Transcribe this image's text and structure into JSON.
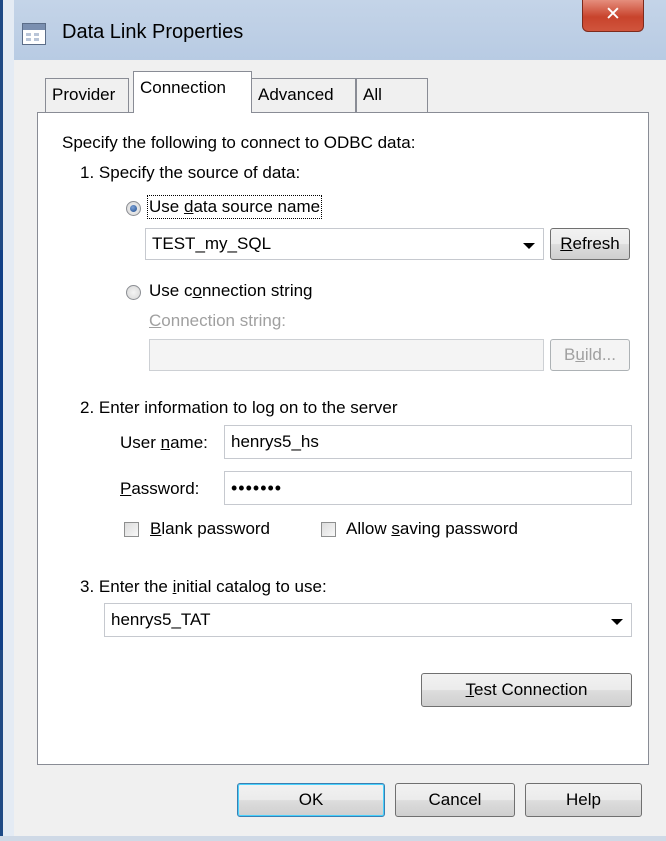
{
  "window": {
    "title": "Data Link Properties",
    "close_glyph": "✕"
  },
  "tabs": [
    {
      "label": "Provider",
      "active": false
    },
    {
      "label": "Connection",
      "active": true
    },
    {
      "label": "Advanced",
      "active": false
    },
    {
      "label": "All",
      "active": false
    }
  ],
  "connection": {
    "intro": "Specify the following to connect to ODBC data:",
    "step1": "1. Specify the source of data:",
    "use_dsn": {
      "pre": "Use ",
      "access_key": "d",
      "post": "ata source name",
      "checked": true
    },
    "dsn_value": "TEST_my_SQL",
    "refresh": {
      "access_key": "R",
      "post": "efresh"
    },
    "use_connstr": {
      "pre": "Use c",
      "access_key": "o",
      "post": "nnection string",
      "checked": false
    },
    "connstr_label": {
      "access_key": "C",
      "post": "onnection string:"
    },
    "connstr_value": "",
    "build": {
      "pre": "B",
      "access_key": "u",
      "post": "ild..."
    },
    "step2": "2. Enter information to log on to the server",
    "username_label": {
      "pre": "User ",
      "access_key": "n",
      "post": "ame:"
    },
    "username_value": "henrys5_hs",
    "password_label": {
      "access_key": "P",
      "post": "assword:"
    },
    "password_value": "•••••••",
    "blank_password": {
      "access_key": "B",
      "post": "lank password",
      "checked": false
    },
    "allow_saving": {
      "pre": "Allow ",
      "access_key": "s",
      "post": "aving password",
      "checked": false
    },
    "step3": {
      "pre": "3. Enter the ",
      "access_key": "i",
      "post": "nitial catalog to use:"
    },
    "catalog_value": "henrys5_TAT",
    "test_connection": {
      "access_key": "T",
      "post": "est Connection"
    }
  },
  "footer": {
    "ok": "OK",
    "cancel": "Cancel",
    "help": "Help"
  },
  "icons": {
    "app": "data-link-icon",
    "close": "close-icon",
    "dropdown": "chevron-down-icon"
  },
  "colors": {
    "close_button": "#c8432c",
    "titlebar": "#b8cbe3",
    "disabled_text": "#a0a0a0"
  }
}
